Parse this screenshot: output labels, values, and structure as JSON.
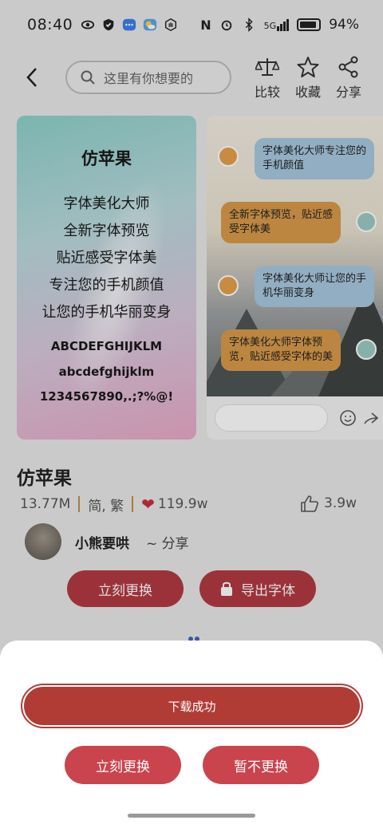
{
  "status_bar": {
    "time": "08:40",
    "battery": "94%",
    "signal_label": "5G"
  },
  "header": {
    "search_placeholder": "这里有你想要的",
    "compare_label": "比较",
    "favorite_label": "收藏",
    "share_label": "分享"
  },
  "preview_left": {
    "font_name": "仿苹果",
    "lines": [
      "字体美化大师",
      "全新字体预览",
      "贴近感受字体美",
      "专注您的手机颜值",
      "让您的手机华丽变身"
    ],
    "uppercase": "ABCDEFGHIJKLM",
    "lowercase": "abcdefghijklm",
    "digits": "1234567890,.;?%@!"
  },
  "preview_right": {
    "bubbles": [
      "字体美化大师专注您的手机颜值",
      "全新字体预览，贴近感受字体美",
      "字体美化大师让您的手机华丽变身",
      "字体美化大师字体预览，贴近感受字体的美"
    ]
  },
  "font_info": {
    "title": "仿苹果",
    "size": "13.77M",
    "scripts": "简, 繁",
    "downloads": "119.9w",
    "likes": "3.9w"
  },
  "author": {
    "name": "小熊要哄",
    "action": "~ 分享"
  },
  "actions": {
    "apply_label": "立刻更换",
    "export_label": "导出字体"
  },
  "sheet": {
    "progress_label": "下载成功",
    "progress": 1.0,
    "apply_label": "立刻更换",
    "later_label": "暂不更换"
  },
  "colors": {
    "primary": "#b13c35",
    "button": "#c9444d",
    "heart": "#c8303f"
  }
}
